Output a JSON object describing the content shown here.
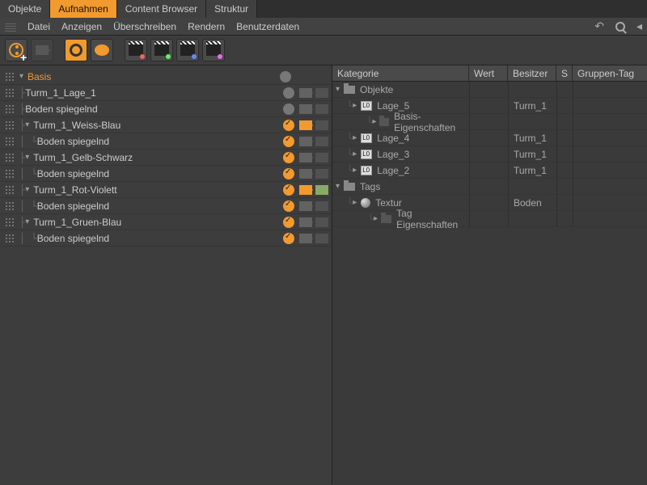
{
  "tabs": [
    "Objekte",
    "Aufnahmen",
    "Content Browser",
    "Struktur"
  ],
  "activeTab": 1,
  "menu": [
    "Datei",
    "Anzeigen",
    "Überschreiben",
    "Rendern",
    "Benutzerdaten"
  ],
  "tree": {
    "root": "Basis",
    "rows": [
      {
        "indent": 1,
        "twist": false,
        "label": "Turm_1_Lage_1",
        "status": "gray",
        "cam": "off",
        "clap": "off"
      },
      {
        "indent": 1,
        "twist": false,
        "label": "Boden spiegelnd",
        "status": "gray",
        "cam": "off",
        "clap": "off"
      },
      {
        "indent": 1,
        "twist": true,
        "label": "Turm_1_Weiss-Blau",
        "status": "check",
        "cam": "on",
        "clap": "off"
      },
      {
        "indent": 2,
        "twist": false,
        "label": "Boden spiegelnd",
        "status": "check",
        "cam": "off",
        "clap": "off"
      },
      {
        "indent": 1,
        "twist": true,
        "label": "Turm_1_Gelb-Schwarz",
        "status": "check",
        "cam": "off",
        "clap": "off"
      },
      {
        "indent": 2,
        "twist": false,
        "label": "Boden spiegelnd",
        "status": "check",
        "cam": "off",
        "clap": "off"
      },
      {
        "indent": 1,
        "twist": true,
        "label": "Turm_1_Rot-Violett",
        "status": "check",
        "cam": "on",
        "clap": "alt"
      },
      {
        "indent": 2,
        "twist": false,
        "label": "Boden spiegelnd",
        "status": "check",
        "cam": "off",
        "clap": "off"
      },
      {
        "indent": 1,
        "twist": true,
        "label": "Turm_1_Gruen-Blau",
        "status": "check",
        "cam": "off",
        "clap": "off"
      },
      {
        "indent": 2,
        "twist": false,
        "label": "Boden spiegelnd",
        "status": "check",
        "cam": "off",
        "clap": "off"
      }
    ]
  },
  "table": {
    "headers": {
      "kategorie": "Kategorie",
      "wert": "Wert",
      "besitzer": "Besitzer",
      "s": "S",
      "gruppen": "Gruppen-Tag"
    },
    "rows": [
      {
        "depth": 0,
        "twist": "▾",
        "icon": "folder",
        "label": "Objekte",
        "besitzer": ""
      },
      {
        "depth": 1,
        "twist": "▸",
        "icon": "lay",
        "label": "Lage_5",
        "besitzer": "Turm_1"
      },
      {
        "depth": 2,
        "twist": "▸",
        "icon": "folder-dark",
        "label": "Basis-Eigenschaften",
        "besitzer": ""
      },
      {
        "depth": 1,
        "twist": "▸",
        "icon": "lay",
        "label": "Lage_4",
        "besitzer": "Turm_1"
      },
      {
        "depth": 1,
        "twist": "▸",
        "icon": "lay",
        "label": "Lage_3",
        "besitzer": "Turm_1"
      },
      {
        "depth": 1,
        "twist": "▸",
        "icon": "lay",
        "label": "Lage_2",
        "besitzer": "Turm_1"
      },
      {
        "depth": 0,
        "twist": "▾",
        "icon": "folder",
        "label": "Tags",
        "besitzer": ""
      },
      {
        "depth": 1,
        "twist": "▸",
        "icon": "sphere",
        "label": "Textur",
        "besitzer": "Boden"
      },
      {
        "depth": 2,
        "twist": "▸",
        "icon": "folder-dark",
        "label": "Tag Eigenschaften",
        "besitzer": ""
      }
    ]
  }
}
